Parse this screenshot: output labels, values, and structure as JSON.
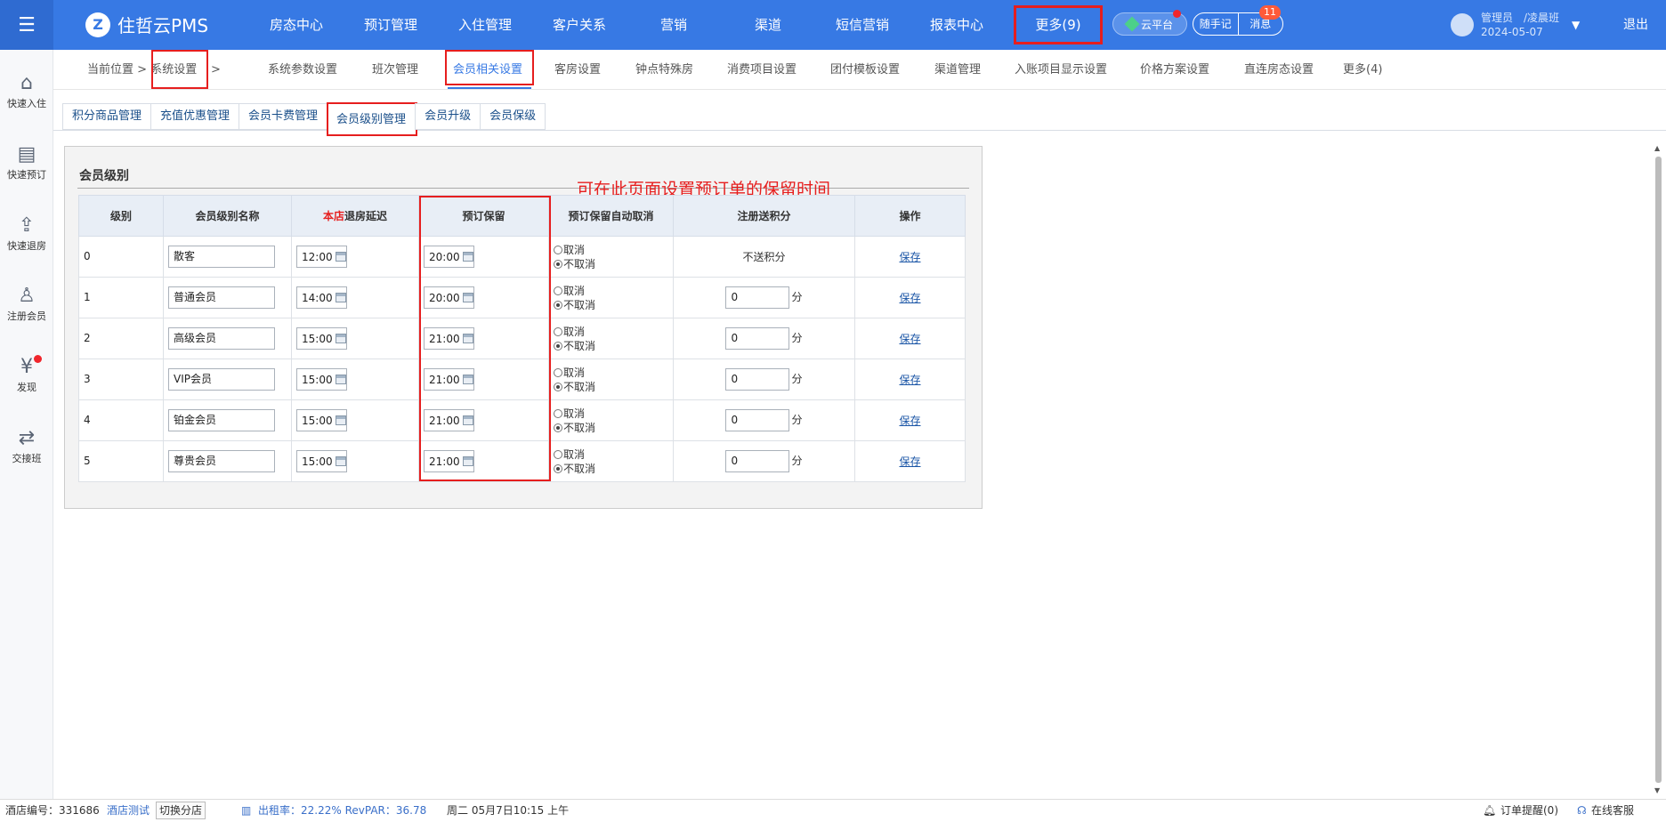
{
  "app": {
    "logo_text": "住哲云PMS",
    "logo_mark": "Z"
  },
  "topnav": {
    "items": [
      "房态中心",
      "预订管理",
      "入住管理",
      "客户关系",
      "营销",
      "渠道",
      "短信营销",
      "报表中心"
    ],
    "more_label": "更多(9)",
    "cloud_label": "云平台",
    "note_label": "随手记",
    "msg_label": "消息",
    "msg_count": "11",
    "user_name": "管理员　/凌晨班",
    "user_date": "2024-05-07",
    "logout_label": "退出"
  },
  "sidebar": {
    "items": [
      {
        "label": "快速入住",
        "icon": "home-icon"
      },
      {
        "label": "快速预订",
        "icon": "clipboard-icon"
      },
      {
        "label": "快速退房",
        "icon": "checkout-icon"
      },
      {
        "label": "注册会员",
        "icon": "add-user-icon"
      },
      {
        "label": "发现",
        "icon": "discover-icon"
      },
      {
        "label": "交接班",
        "icon": "shift-handover-icon"
      }
    ]
  },
  "breadcrumb": {
    "location_label": "当前位置",
    "sep": ">",
    "current": "系统设置",
    "sep2": ">"
  },
  "subnav": {
    "tabs": [
      "系统参数设置",
      "班次管理",
      "会员相关设置",
      "客房设置",
      "钟点特殊房",
      "消费项目设置",
      "团付模板设置",
      "渠道管理",
      "入账项目显示设置",
      "价格方案设置",
      "直连房态设置",
      "更多(4)"
    ],
    "active": "会员相关设置"
  },
  "tabs3": {
    "items": [
      "积分商品管理",
      "充值优惠管理",
      "会员卡费管理",
      "会员级别管理",
      "会员升级",
      "会员保级"
    ],
    "active": "会员级别管理"
  },
  "panel": {
    "title": "会员级别",
    "annotation": "可在此页面设置预订单的保留时间"
  },
  "table": {
    "headers": {
      "level": "级别",
      "name": "会员级别名称",
      "delay_prefix": "本店",
      "delay_rest": "退房延迟",
      "hold": "预订保留",
      "auto_cancel": "预订保留自动取消",
      "points": "注册送积分",
      "op": "操作"
    },
    "radio_labels": {
      "cancel": "取消",
      "no_cancel": "不取消"
    },
    "points_unit": "分",
    "save_label": "保存",
    "no_points_text": "不送积分",
    "rows": [
      {
        "level": "0",
        "name": "散客",
        "delay": "12:00",
        "hold": "20:00",
        "points": null
      },
      {
        "level": "1",
        "name": "普通会员",
        "delay": "14:00",
        "hold": "20:00",
        "points": "0"
      },
      {
        "level": "2",
        "name": "高级会员",
        "delay": "15:00",
        "hold": "21:00",
        "points": "0"
      },
      {
        "level": "3",
        "name": "VIP会员",
        "delay": "15:00",
        "hold": "21:00",
        "points": "0"
      },
      {
        "level": "4",
        "name": "铂金会员",
        "delay": "15:00",
        "hold": "21:00",
        "points": "0"
      },
      {
        "level": "5",
        "name": "尊贵会员",
        "delay": "15:00",
        "hold": "21:00",
        "points": "0"
      }
    ]
  },
  "footer": {
    "hotel_no_label": "酒店编号：331686",
    "hotel_name": "酒店测试",
    "switch_label": "切换分店",
    "stats": "出租率：22.22% RevPAR：36.78",
    "datetime": "周二 05月7日10:15 上午",
    "order_remind": "订单提醒(0)",
    "online_service": "在线客服"
  }
}
